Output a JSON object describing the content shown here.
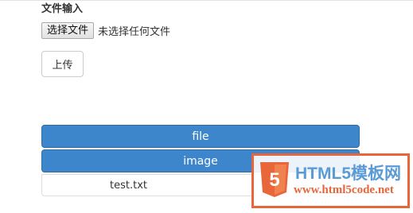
{
  "form": {
    "label": "文件输入",
    "choose_button": "选择文件",
    "no_file_text": "未选择任何文件",
    "upload_button": "上传"
  },
  "buttons": {
    "file": "file",
    "image": "image"
  },
  "file_list": [
    {
      "name": "test.txt"
    }
  ],
  "watermark": {
    "title": "HTML5模板网",
    "url": "www.html5code.net",
    "shield_text": "5",
    "accent_color": "#e8663a",
    "title_color": "#5b9bd5"
  },
  "colors": {
    "primary_button": "#3d86cc",
    "primary_button_border": "#2e6da4"
  }
}
